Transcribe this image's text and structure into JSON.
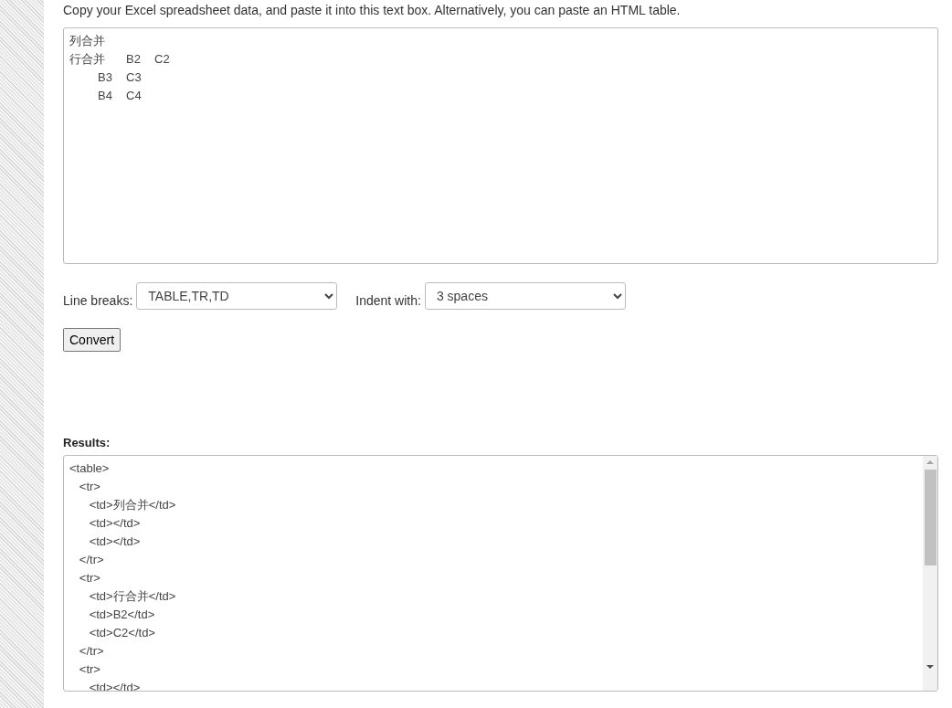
{
  "instructions": "Copy your Excel spreadsheet data, and paste it into this text box. Alternatively, you can paste an HTML table.",
  "input": {
    "lines": [
      "列合并",
      "行合并\tB2\tC2",
      "\tB3\tC3",
      "\tB4\tC4"
    ]
  },
  "options": [
    {
      "label": "Line breaks:",
      "value": "TABLE,TR,TD"
    },
    {
      "label": "Indent with:",
      "value": "3 spaces"
    }
  ],
  "convert_button": "Convert",
  "results": {
    "label": "Results:",
    "value": "<table>\n   <tr>\n      <td>列合并</td>\n      <td></td>\n      <td></td>\n   </tr>\n   <tr>\n      <td>行合并</td>\n      <td>B2</td>\n      <td>C2</td>\n   </tr>\n   <tr>\n      <td></td>"
  }
}
